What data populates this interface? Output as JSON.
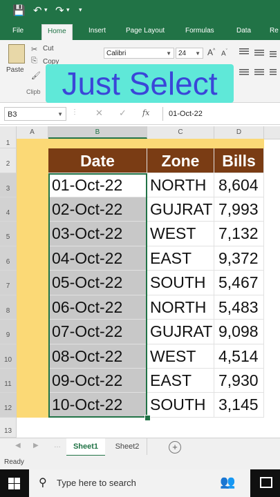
{
  "app": {
    "accent": "#217346"
  },
  "tabs": [
    {
      "label": "File"
    },
    {
      "label": "Home"
    },
    {
      "label": "Insert"
    },
    {
      "label": "Page Layout"
    },
    {
      "label": "Formulas"
    },
    {
      "label": "Data"
    },
    {
      "label": "Re"
    }
  ],
  "ribbon": {
    "paste_label": "Paste",
    "cut_label": "Cut",
    "copy_label": "Copy",
    "clipboard_label": "Clipb",
    "font_name": "Calibri",
    "font_size": "24"
  },
  "overlay": {
    "text": "Just Select"
  },
  "formula_bar": {
    "name_box": "B3",
    "fx": "fx",
    "value": "01-Oct-22"
  },
  "grid": {
    "columns": [
      "A",
      "B",
      "C",
      "D"
    ],
    "rows": [
      "1",
      "2",
      "3",
      "4",
      "5",
      "6",
      "7",
      "8",
      "9",
      "10",
      "11",
      "12",
      "13"
    ],
    "headers": [
      "Date",
      "Zone",
      "Bills"
    ],
    "data": [
      [
        "01-Oct-22",
        "NORTH",
        "8,604"
      ],
      [
        "02-Oct-22",
        "GUJRAT",
        "7,993"
      ],
      [
        "03-Oct-22",
        "WEST",
        "7,132"
      ],
      [
        "04-Oct-22",
        "EAST",
        "9,372"
      ],
      [
        "05-Oct-22",
        "SOUTH",
        "5,467"
      ],
      [
        "06-Oct-22",
        "NORTH",
        "5,483"
      ],
      [
        "07-Oct-22",
        "GUJRAT",
        "9,098"
      ],
      [
        "08-Oct-22",
        "WEST",
        "4,514"
      ],
      [
        "09-Oct-22",
        "EAST",
        "7,930"
      ],
      [
        "10-Oct-22",
        "SOUTH",
        "3,145"
      ]
    ],
    "header_color": "#7a3c14",
    "highlight_color": "#fbd976"
  },
  "sheets": [
    {
      "label": "Sheet1"
    },
    {
      "label": "Sheet2"
    }
  ],
  "status": {
    "text": "Ready"
  },
  "taskbar": {
    "search_placeholder": "Type here to search"
  }
}
